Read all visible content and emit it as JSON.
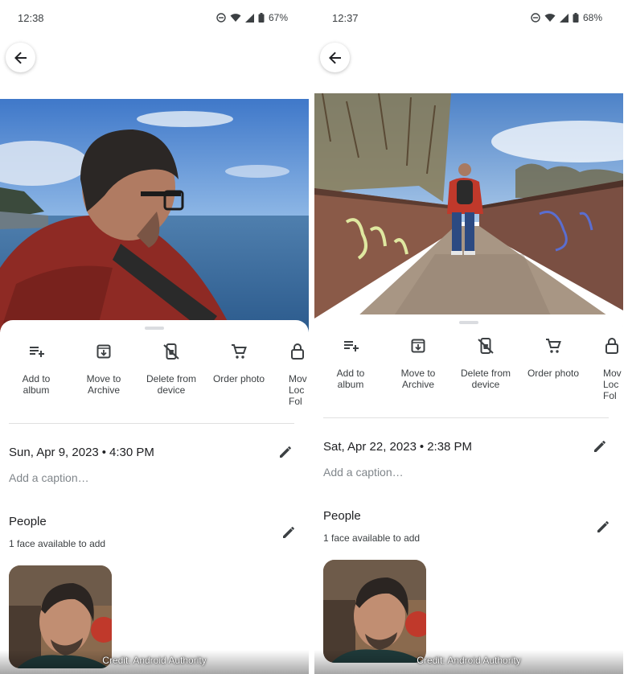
{
  "colors": {
    "icon": "#3c4043",
    "text_primary": "#202124",
    "text_secondary": "#80868b",
    "divider": "#e0e0e0"
  },
  "screens": [
    {
      "status_bar": {
        "time": "12:38",
        "battery": "67%",
        "icons": [
          "dnd-icon",
          "wifi-icon",
          "signal-icon",
          "battery-icon"
        ]
      },
      "photo": {
        "subject": "man-in-red-jacket-by-sea"
      },
      "actions": [
        {
          "label": "Add to\nalbum",
          "icon": "add-to-playlist-icon"
        },
        {
          "label": "Move to\nArchive",
          "icon": "archive-icon"
        },
        {
          "label": "Delete from\ndevice",
          "icon": "delete-from-device-icon"
        },
        {
          "label": "Order photo",
          "icon": "cart-icon"
        },
        {
          "label": "Mov\nLoc\nFol",
          "icon": "lock-icon"
        }
      ],
      "date": "Sun, Apr 9, 2023",
      "time": "4:30 PM",
      "caption_placeholder": "Add a caption…",
      "people_title": "People",
      "people_subtitle": "1 face available to add",
      "credit": "Credit: Android Authority"
    },
    {
      "status_bar": {
        "time": "12:37",
        "battery": "68%",
        "icons": [
          "dnd-icon",
          "wifi-icon",
          "signal-icon",
          "battery-icon"
        ]
      },
      "photo": {
        "subject": "man-walking-on-bridge"
      },
      "actions": [
        {
          "label": "Add to\nalbum",
          "icon": "add-to-playlist-icon"
        },
        {
          "label": "Move to\nArchive",
          "icon": "archive-icon"
        },
        {
          "label": "Delete from\ndevice",
          "icon": "delete-from-device-icon"
        },
        {
          "label": "Order photo",
          "icon": "cart-icon"
        },
        {
          "label": "Mov\nLoc\nFol",
          "icon": "lock-icon"
        }
      ],
      "date": "Sat, Apr 22, 2023",
      "time": "2:38 PM",
      "caption_placeholder": "Add a caption…",
      "people_title": "People",
      "people_subtitle": "1 face available to add",
      "credit": "Credit: Android Authority"
    }
  ]
}
